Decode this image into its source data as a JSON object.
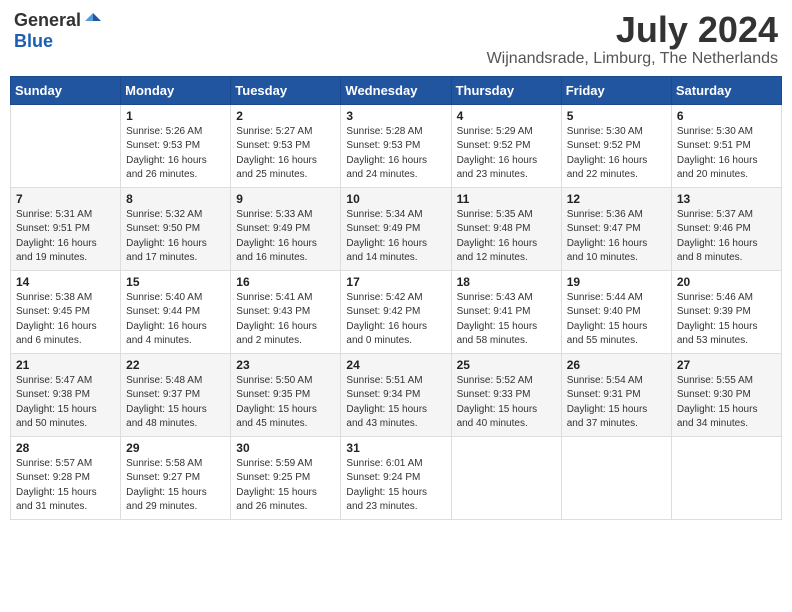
{
  "header": {
    "logo_general": "General",
    "logo_blue": "Blue",
    "month_year": "July 2024",
    "location": "Wijnandsrade, Limburg, The Netherlands"
  },
  "weekdays": [
    "Sunday",
    "Monday",
    "Tuesday",
    "Wednesday",
    "Thursday",
    "Friday",
    "Saturday"
  ],
  "weeks": [
    [
      {
        "day": "",
        "sunrise": "",
        "sunset": "",
        "daylight": ""
      },
      {
        "day": "1",
        "sunrise": "Sunrise: 5:26 AM",
        "sunset": "Sunset: 9:53 PM",
        "daylight": "Daylight: 16 hours and 26 minutes."
      },
      {
        "day": "2",
        "sunrise": "Sunrise: 5:27 AM",
        "sunset": "Sunset: 9:53 PM",
        "daylight": "Daylight: 16 hours and 25 minutes."
      },
      {
        "day": "3",
        "sunrise": "Sunrise: 5:28 AM",
        "sunset": "Sunset: 9:53 PM",
        "daylight": "Daylight: 16 hours and 24 minutes."
      },
      {
        "day": "4",
        "sunrise": "Sunrise: 5:29 AM",
        "sunset": "Sunset: 9:52 PM",
        "daylight": "Daylight: 16 hours and 23 minutes."
      },
      {
        "day": "5",
        "sunrise": "Sunrise: 5:30 AM",
        "sunset": "Sunset: 9:52 PM",
        "daylight": "Daylight: 16 hours and 22 minutes."
      },
      {
        "day": "6",
        "sunrise": "Sunrise: 5:30 AM",
        "sunset": "Sunset: 9:51 PM",
        "daylight": "Daylight: 16 hours and 20 minutes."
      }
    ],
    [
      {
        "day": "7",
        "sunrise": "Sunrise: 5:31 AM",
        "sunset": "Sunset: 9:51 PM",
        "daylight": "Daylight: 16 hours and 19 minutes."
      },
      {
        "day": "8",
        "sunrise": "Sunrise: 5:32 AM",
        "sunset": "Sunset: 9:50 PM",
        "daylight": "Daylight: 16 hours and 17 minutes."
      },
      {
        "day": "9",
        "sunrise": "Sunrise: 5:33 AM",
        "sunset": "Sunset: 9:49 PM",
        "daylight": "Daylight: 16 hours and 16 minutes."
      },
      {
        "day": "10",
        "sunrise": "Sunrise: 5:34 AM",
        "sunset": "Sunset: 9:49 PM",
        "daylight": "Daylight: 16 hours and 14 minutes."
      },
      {
        "day": "11",
        "sunrise": "Sunrise: 5:35 AM",
        "sunset": "Sunset: 9:48 PM",
        "daylight": "Daylight: 16 hours and 12 minutes."
      },
      {
        "day": "12",
        "sunrise": "Sunrise: 5:36 AM",
        "sunset": "Sunset: 9:47 PM",
        "daylight": "Daylight: 16 hours and 10 minutes."
      },
      {
        "day": "13",
        "sunrise": "Sunrise: 5:37 AM",
        "sunset": "Sunset: 9:46 PM",
        "daylight": "Daylight: 16 hours and 8 minutes."
      }
    ],
    [
      {
        "day": "14",
        "sunrise": "Sunrise: 5:38 AM",
        "sunset": "Sunset: 9:45 PM",
        "daylight": "Daylight: 16 hours and 6 minutes."
      },
      {
        "day": "15",
        "sunrise": "Sunrise: 5:40 AM",
        "sunset": "Sunset: 9:44 PM",
        "daylight": "Daylight: 16 hours and 4 minutes."
      },
      {
        "day": "16",
        "sunrise": "Sunrise: 5:41 AM",
        "sunset": "Sunset: 9:43 PM",
        "daylight": "Daylight: 16 hours and 2 minutes."
      },
      {
        "day": "17",
        "sunrise": "Sunrise: 5:42 AM",
        "sunset": "Sunset: 9:42 PM",
        "daylight": "Daylight: 16 hours and 0 minutes."
      },
      {
        "day": "18",
        "sunrise": "Sunrise: 5:43 AM",
        "sunset": "Sunset: 9:41 PM",
        "daylight": "Daylight: 15 hours and 58 minutes."
      },
      {
        "day": "19",
        "sunrise": "Sunrise: 5:44 AM",
        "sunset": "Sunset: 9:40 PM",
        "daylight": "Daylight: 15 hours and 55 minutes."
      },
      {
        "day": "20",
        "sunrise": "Sunrise: 5:46 AM",
        "sunset": "Sunset: 9:39 PM",
        "daylight": "Daylight: 15 hours and 53 minutes."
      }
    ],
    [
      {
        "day": "21",
        "sunrise": "Sunrise: 5:47 AM",
        "sunset": "Sunset: 9:38 PM",
        "daylight": "Daylight: 15 hours and 50 minutes."
      },
      {
        "day": "22",
        "sunrise": "Sunrise: 5:48 AM",
        "sunset": "Sunset: 9:37 PM",
        "daylight": "Daylight: 15 hours and 48 minutes."
      },
      {
        "day": "23",
        "sunrise": "Sunrise: 5:50 AM",
        "sunset": "Sunset: 9:35 PM",
        "daylight": "Daylight: 15 hours and 45 minutes."
      },
      {
        "day": "24",
        "sunrise": "Sunrise: 5:51 AM",
        "sunset": "Sunset: 9:34 PM",
        "daylight": "Daylight: 15 hours and 43 minutes."
      },
      {
        "day": "25",
        "sunrise": "Sunrise: 5:52 AM",
        "sunset": "Sunset: 9:33 PM",
        "daylight": "Daylight: 15 hours and 40 minutes."
      },
      {
        "day": "26",
        "sunrise": "Sunrise: 5:54 AM",
        "sunset": "Sunset: 9:31 PM",
        "daylight": "Daylight: 15 hours and 37 minutes."
      },
      {
        "day": "27",
        "sunrise": "Sunrise: 5:55 AM",
        "sunset": "Sunset: 9:30 PM",
        "daylight": "Daylight: 15 hours and 34 minutes."
      }
    ],
    [
      {
        "day": "28",
        "sunrise": "Sunrise: 5:57 AM",
        "sunset": "Sunset: 9:28 PM",
        "daylight": "Daylight: 15 hours and 31 minutes."
      },
      {
        "day": "29",
        "sunrise": "Sunrise: 5:58 AM",
        "sunset": "Sunset: 9:27 PM",
        "daylight": "Daylight: 15 hours and 29 minutes."
      },
      {
        "day": "30",
        "sunrise": "Sunrise: 5:59 AM",
        "sunset": "Sunset: 9:25 PM",
        "daylight": "Daylight: 15 hours and 26 minutes."
      },
      {
        "day": "31",
        "sunrise": "Sunrise: 6:01 AM",
        "sunset": "Sunset: 9:24 PM",
        "daylight": "Daylight: 15 hours and 23 minutes."
      },
      {
        "day": "",
        "sunrise": "",
        "sunset": "",
        "daylight": ""
      },
      {
        "day": "",
        "sunrise": "",
        "sunset": "",
        "daylight": ""
      },
      {
        "day": "",
        "sunrise": "",
        "sunset": "",
        "daylight": ""
      }
    ]
  ]
}
